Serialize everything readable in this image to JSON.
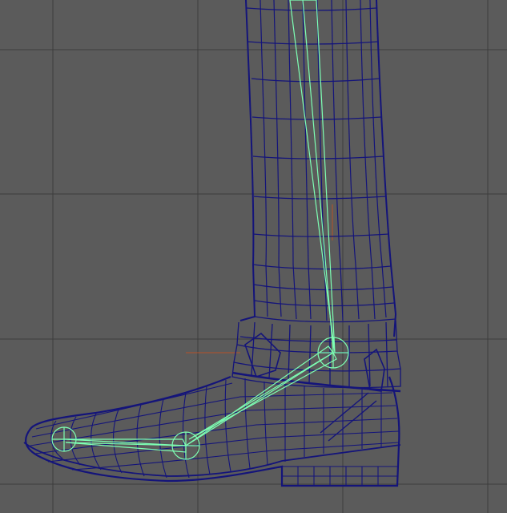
{
  "viewport": {
    "background_color": "#5b5b5b",
    "grid_color": "#3c3c3c",
    "wireframe_color": "#14147a",
    "skeleton_color": "#7dffb4",
    "axis_marker_color": "#b45028"
  },
  "scene": {
    "object": "boot-leg-wireframe",
    "joints": [
      "ankle-joint",
      "ball-joint",
      "toe-joint"
    ]
  }
}
